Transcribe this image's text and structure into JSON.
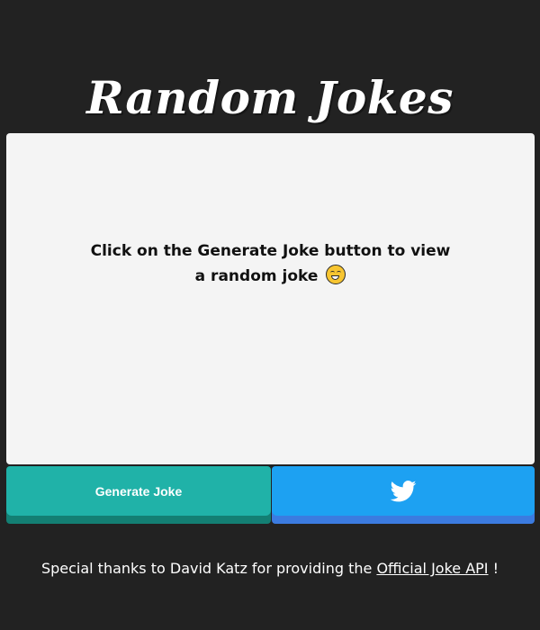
{
  "header": {
    "title": "Random Jokes"
  },
  "joke": {
    "text": "Click on the Generate Joke button to view a random joke",
    "emoji_icon": "grinning-face-icon"
  },
  "buttons": {
    "generate_label": "Generate Joke",
    "tweet_icon": "twitter-bird-icon"
  },
  "footer": {
    "text_before": "Special thanks to David Katz for providing the",
    "link_text": "Official Joke API",
    "text_after": "!"
  },
  "colors": {
    "background": "#222222",
    "card": "#f4f4f4",
    "generate_button": "#20b2a8",
    "tweet_button": "#1da1f2"
  }
}
